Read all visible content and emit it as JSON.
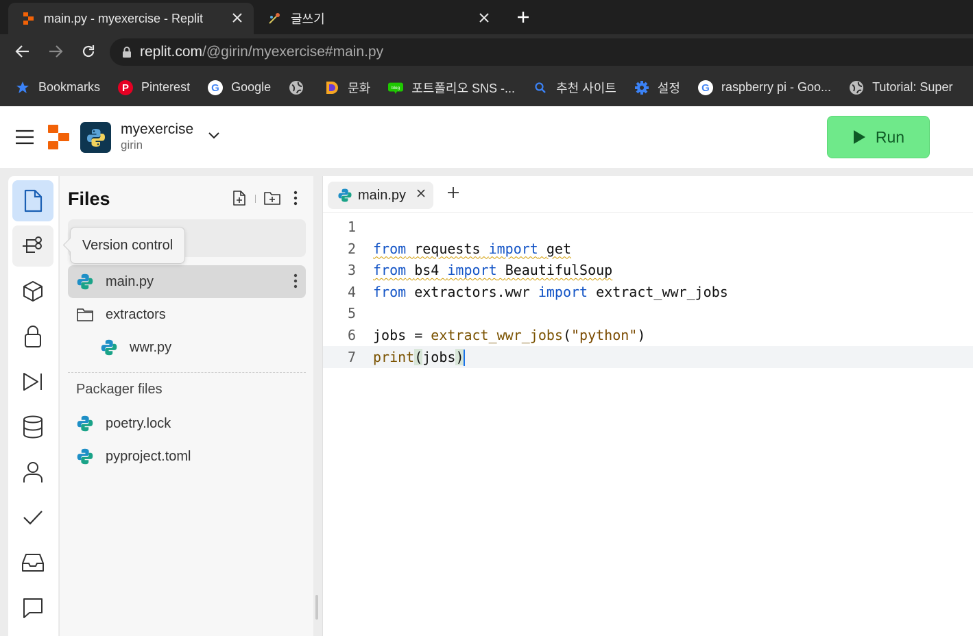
{
  "browser": {
    "tabs": [
      {
        "title": "main.py - myexercise - Replit",
        "active": true,
        "icon": "replit-icon"
      },
      {
        "title": "글쓰기",
        "active": false,
        "icon": "writing-icon"
      }
    ],
    "new_tab_icon": "plus-icon",
    "url_host": "replit.com",
    "url_path": "/@girin/myexercise#main.py",
    "bookmarks": [
      {
        "label": "Bookmarks",
        "icon": "star-icon"
      },
      {
        "label": "Pinterest",
        "icon": "pinterest-icon"
      },
      {
        "label": "Google",
        "icon": "google-icon"
      },
      {
        "label": "",
        "icon": "globe-icon"
      },
      {
        "label": "문화",
        "icon": "d-icon"
      },
      {
        "label": "포트폴리오 SNS -...",
        "icon": "blog-icon"
      },
      {
        "label": "추천 사이트",
        "icon": "search-icon"
      },
      {
        "label": "설정",
        "icon": "gear-icon"
      },
      {
        "label": "raspberry pi - Goo...",
        "icon": "google-icon"
      },
      {
        "label": "Tutorial: Super",
        "icon": "globe-icon"
      }
    ]
  },
  "header": {
    "project_name": "myexercise",
    "owner": "girin",
    "run_label": "Run"
  },
  "files_panel": {
    "title": "Files",
    "tooltip": "Version control",
    "files": [
      {
        "name": "main.py",
        "selected": true
      },
      {
        "name": "extractors",
        "type": "folder"
      },
      {
        "name": "wwr.py",
        "indent": true
      }
    ],
    "packager_title": "Packager files",
    "packager_files": [
      {
        "name": "poetry.lock"
      },
      {
        "name": "pyproject.toml"
      }
    ]
  },
  "editor": {
    "tab_name": "main.py",
    "lines": [
      {
        "n": "1",
        "tokens": []
      },
      {
        "n": "2",
        "tokens": [
          {
            "t": "from",
            "c": "kw squig"
          },
          {
            "t": " ",
            "c": "squig"
          },
          {
            "t": "requests",
            "c": "squig"
          },
          {
            "t": " ",
            "c": "squig"
          },
          {
            "t": "import",
            "c": "kw squig"
          },
          {
            "t": " ",
            "c": "squig"
          },
          {
            "t": "get",
            "c": "squig"
          }
        ]
      },
      {
        "n": "3",
        "tokens": [
          {
            "t": "from",
            "c": "kw squig"
          },
          {
            "t": " ",
            "c": "squig"
          },
          {
            "t": "bs4",
            "c": "squig"
          },
          {
            "t": " ",
            "c": "squig"
          },
          {
            "t": "import",
            "c": "kw squig"
          },
          {
            "t": " ",
            "c": "squig"
          },
          {
            "t": "BeautifulSoup",
            "c": "squig"
          }
        ]
      },
      {
        "n": "4",
        "tokens": [
          {
            "t": "from",
            "c": "kw"
          },
          {
            "t": " extractors.wwr ",
            "c": ""
          },
          {
            "t": "import",
            "c": "kw"
          },
          {
            "t": " extract_wwr_jobs",
            "c": ""
          }
        ]
      },
      {
        "n": "5",
        "tokens": []
      },
      {
        "n": "6",
        "tokens": [
          {
            "t": "jobs = ",
            "c": ""
          },
          {
            "t": "extract_wwr_jobs",
            "c": "fn"
          },
          {
            "t": "(",
            "c": ""
          },
          {
            "t": "\"python\"",
            "c": "str"
          },
          {
            "t": ")",
            "c": ""
          }
        ]
      },
      {
        "n": "7",
        "tokens": [
          {
            "t": "print",
            "c": "fn"
          },
          {
            "t": "(",
            "c": "bracket-hl"
          },
          {
            "t": "jobs",
            "c": ""
          },
          {
            "t": ")",
            "c": "bracket-hl"
          }
        ]
      }
    ]
  },
  "colors": {
    "run_button": "#6fe98a",
    "active_rail": "#cfe3fb",
    "keyword": "#1354c6"
  }
}
